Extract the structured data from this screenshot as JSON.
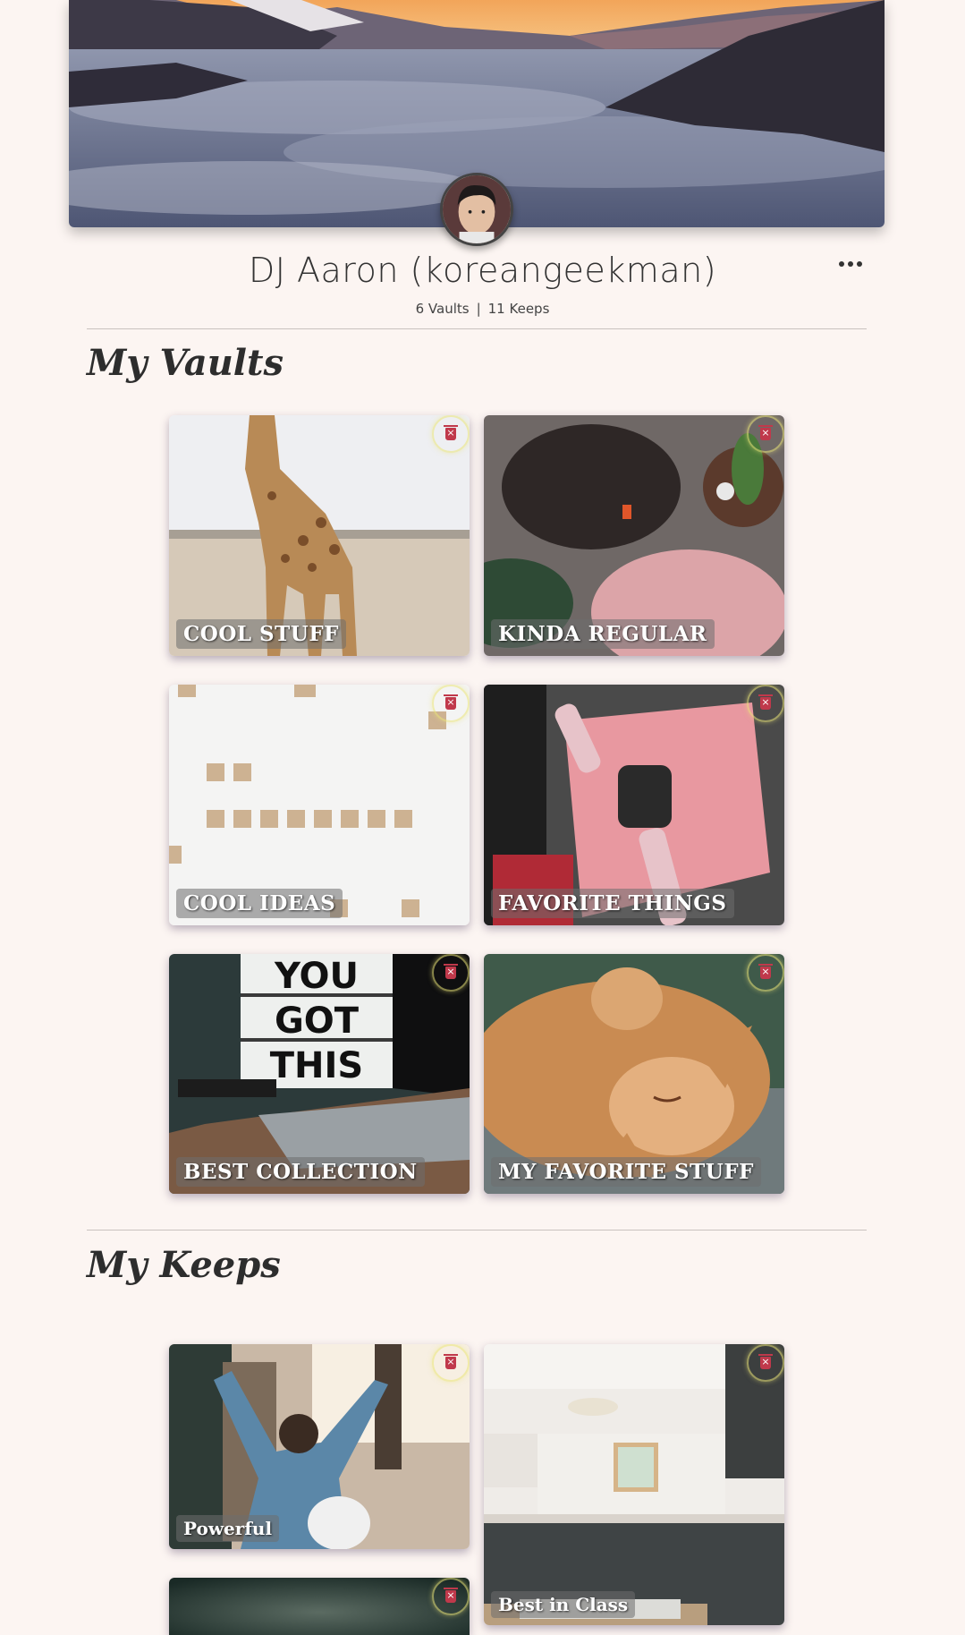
{
  "profile": {
    "name": "DJ Aaron (koreangeekman)",
    "vaults_count": "6 Vaults",
    "separator": "|",
    "keeps_count": "11 Keeps"
  },
  "sections": {
    "vaults_title": "My Vaults",
    "keeps_title": "My Keeps"
  },
  "vaults": [
    {
      "label": "COOL STUFF",
      "image": "giraffe"
    },
    {
      "label": "KINDA REGULAR",
      "image": "knit-hats"
    },
    {
      "label": "COOL IDEAS",
      "image": "scrabble-tiles"
    },
    {
      "label": "FAVORITE THINGS",
      "image": "watch-notebook"
    },
    {
      "label": "BEST COLLECTION",
      "image": "lightbox-laptop"
    },
    {
      "label": "MY FAVORITE STUFF",
      "image": "sleeping-cat"
    }
  ],
  "keeps": [
    {
      "label": "Powerful",
      "image": "person-arms-raised"
    },
    {
      "label": "Best in Class",
      "image": "kitchen"
    },
    {
      "label": "",
      "image": "dark-blur"
    }
  ],
  "colors": {
    "background": "#fcf5f2",
    "delete_icon": "#c0394b",
    "delete_ring": "#ebe678"
  }
}
